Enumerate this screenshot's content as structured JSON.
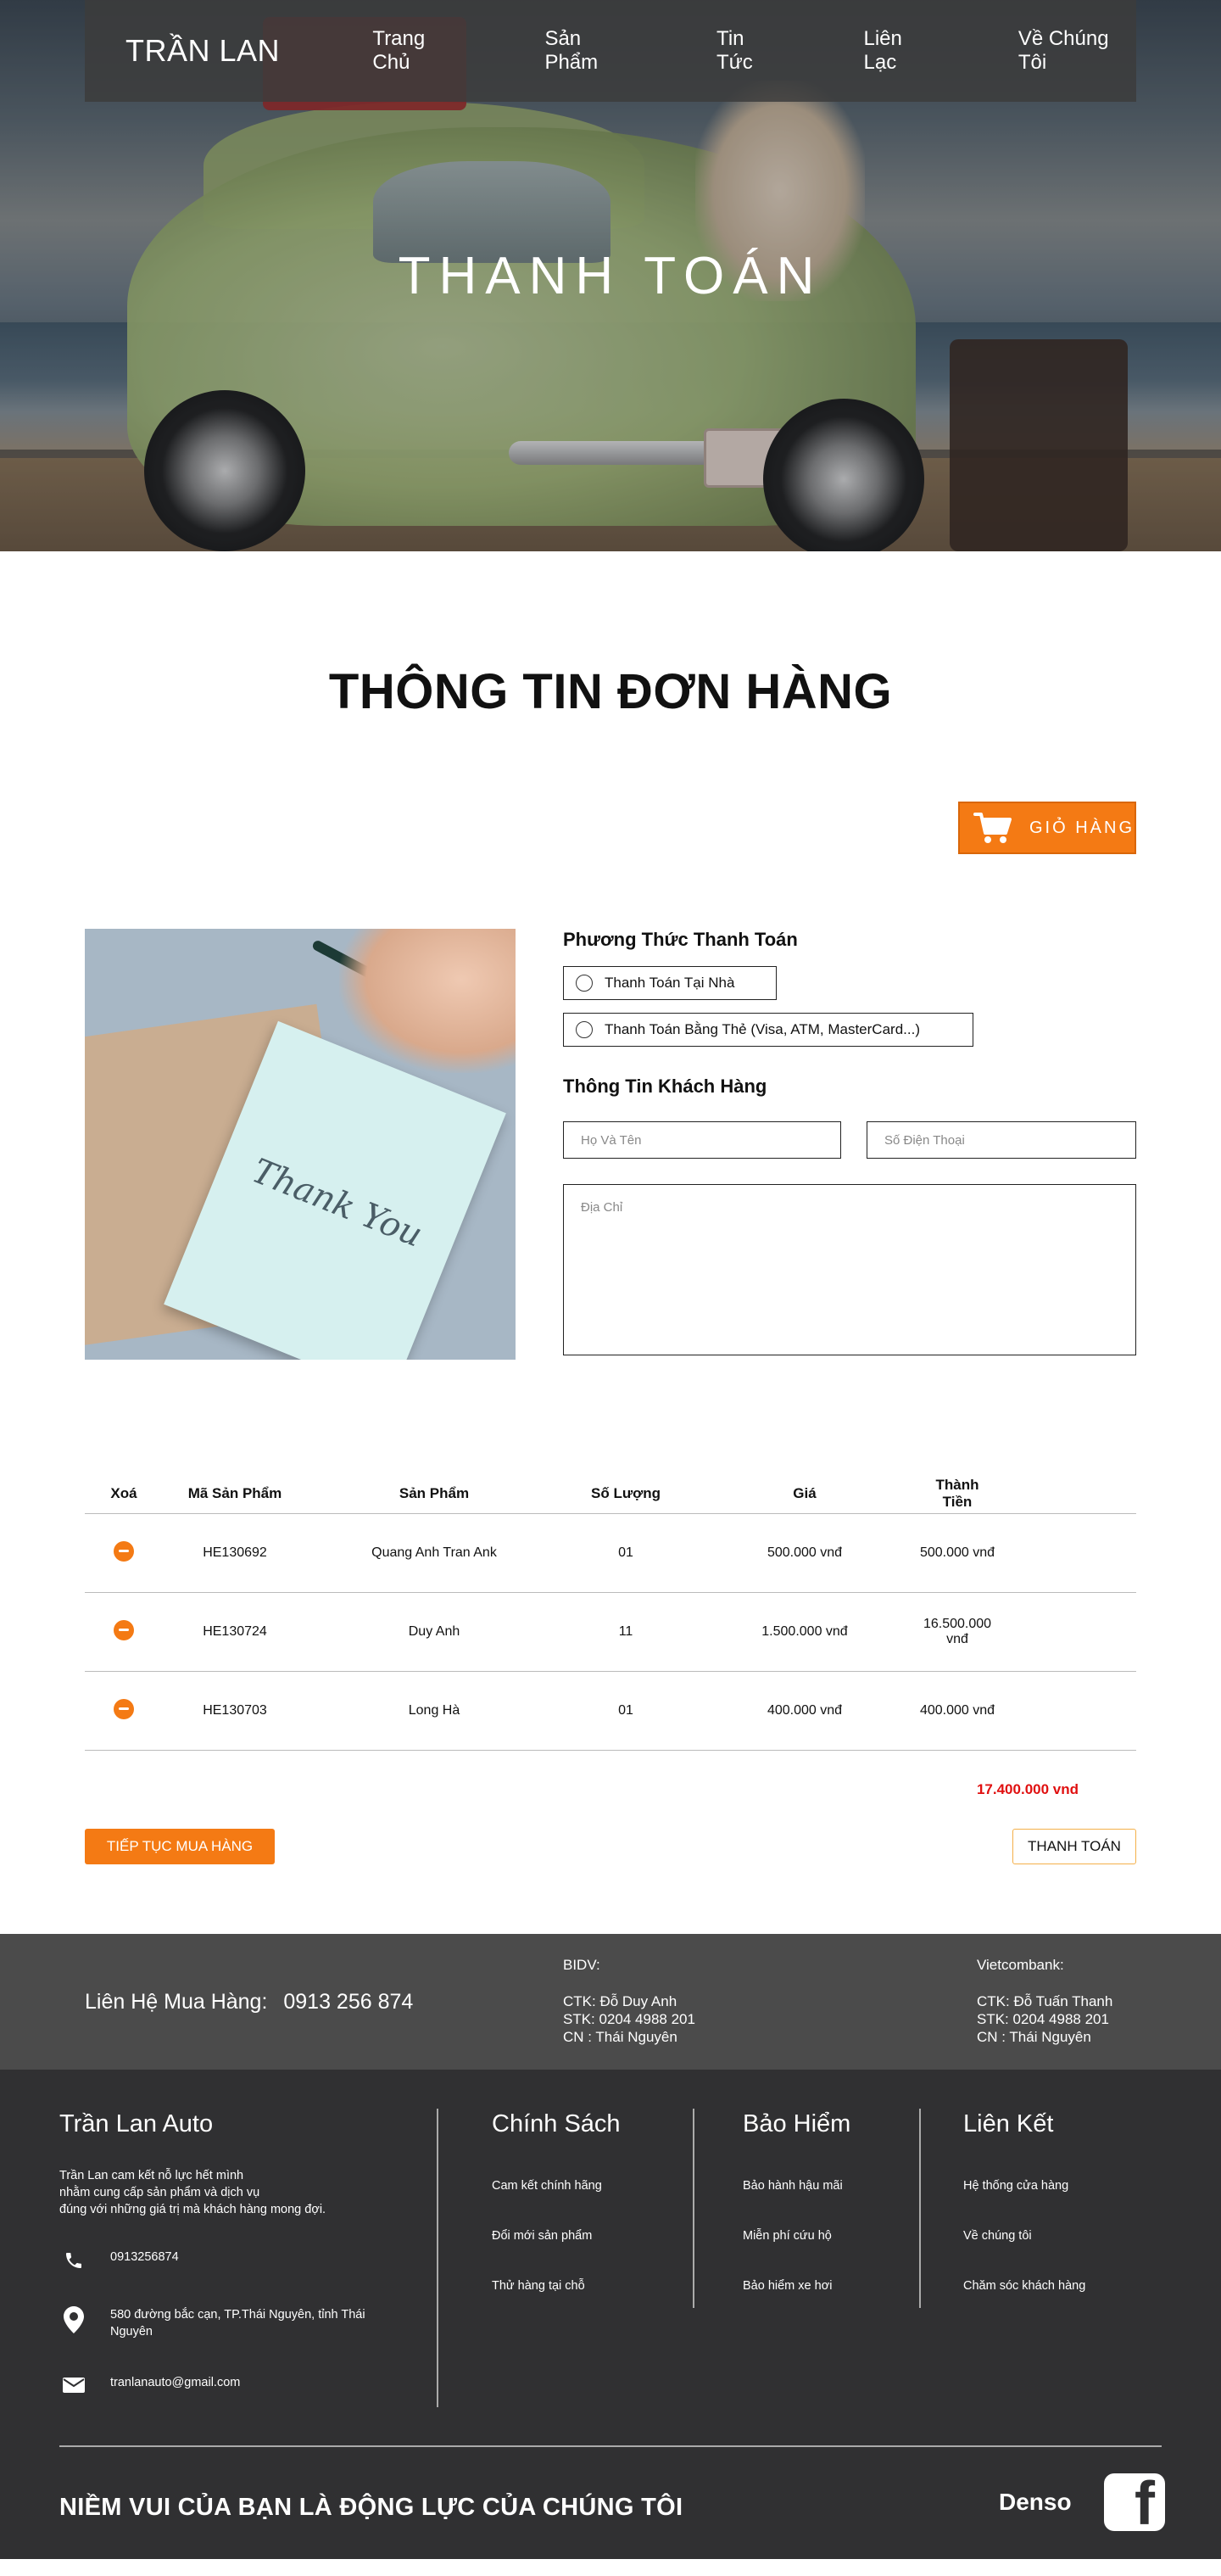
{
  "nav": {
    "logo": "TRẦN LAN",
    "items": [
      "Trang Chủ",
      "Sản Phẩm",
      "Tin Tức",
      "Liên Lạc",
      "Về Chúng Tôi"
    ]
  },
  "hero": {
    "title": "THANH TOÁN"
  },
  "order": {
    "title": "THÔNG TIN ĐƠN HÀNG",
    "cart_button": "GIỎ HÀNG",
    "cart_icon": "cart-icon",
    "photo_text": "Thank You"
  },
  "payment": {
    "method_heading": "Phương Thức Thanh Toán",
    "options": [
      "Thanh Toán Tại Nhà",
      "Thanh Toán Bằng Thẻ (Visa, ATM, MasterCard...)"
    ],
    "customer_heading": "Thông Tin Khách Hàng",
    "name_placeholder": "Họ Và Tên",
    "phone_placeholder": "Số Điện Thoại",
    "address_placeholder": "Địa Chỉ"
  },
  "table": {
    "headers": [
      "Xoá",
      "Mã Sản Phẩm",
      "Sản Phẩm",
      "Số Lượng",
      "Giá",
      "Thành Tiền"
    ],
    "rows": [
      {
        "code": "HE130692",
        "product": "Quang Anh Tran Ank",
        "qty": "01",
        "price": "500.000 vnđ",
        "total": "500.000 vnđ"
      },
      {
        "code": "HE130724",
        "product": "Duy Anh",
        "qty": "11",
        "price": "1.500.000 vnđ",
        "total": "16.500.000 vnđ"
      },
      {
        "code": "HE130703",
        "product": "Long Hà",
        "qty": "01",
        "price": "400.000 vnđ",
        "total": "400.000 vnđ"
      }
    ],
    "grand_total": "17.400.000 vnd"
  },
  "actions": {
    "continue": "TIẾP TỤC MUA HÀNG",
    "pay": "THANH TOÁN"
  },
  "contact": {
    "label": "Liên Hệ Mua Hàng:",
    "phone": "0913 256 874",
    "banks": [
      {
        "name": "BIDV:",
        "lines": [
          "CTK: Đỗ Duy Anh",
          "STK: 0204 4988 201",
          "CN  : Thái Nguyên"
        ]
      },
      {
        "name": "Vietcombank:",
        "lines": [
          "CTK: Đỗ Tuấn Thanh",
          "STK: 0204 4988 201",
          "CN  : Thái Nguyên"
        ]
      }
    ]
  },
  "footer": {
    "about_title": "Trần Lan Auto",
    "about_desc": [
      "Trần Lan cam kết nỗ lực hết mình",
      "nhằm cung cấp sản phẩm và dịch vụ",
      "đúng với những giá trị mà khách hàng mong đợi."
    ],
    "phone": "0913256874",
    "address": "580 đường bắc cạn, TP.Thái Nguyên, tỉnh Thái Nguyên",
    "email": "tranlanauto@gmail.com",
    "policy_title": "Chính Sách",
    "policy_items": [
      "Cam kết chính hãng",
      "Đổi mới sản phẩm",
      "Thử hàng tại chỗ"
    ],
    "insurance_title": "Bảo Hiểm",
    "insurance_items": [
      "Bảo hành hậu mãi",
      "Miễn phí cứu hộ",
      "Bảo hiểm xe hơi"
    ],
    "links_title": "Liên Kết",
    "links_items": [
      "Hệ thống cửa hàng",
      "Về chúng tôi",
      "Chăm sóc khách hàng"
    ],
    "slogan": "NIỀM VUI CỦA BẠN LÀ ĐỘNG LỰC CỦA CHÚNG TÔI",
    "brand": "Denso",
    "social_icon": "facebook-icon"
  }
}
